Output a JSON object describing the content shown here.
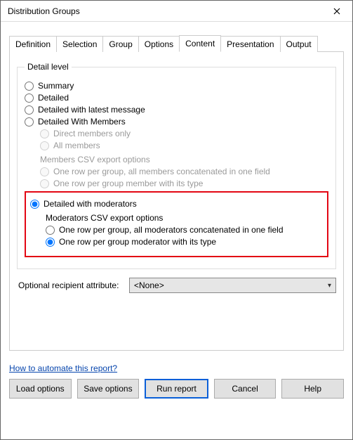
{
  "window": {
    "title": "Distribution Groups"
  },
  "tabs": {
    "items": [
      "Definition",
      "Selection",
      "Group",
      "Options",
      "Content",
      "Presentation",
      "Output"
    ],
    "active": "Content"
  },
  "detail": {
    "legend": "Detail level",
    "summary": "Summary",
    "detailed": "Detailed",
    "detailed_latest": "Detailed with latest message",
    "detailed_members": "Detailed With Members",
    "direct_only": "Direct members only",
    "all_members": "All members",
    "members_csv_head": "Members CSV export options",
    "members_csv_one_row_concat": "One row per group, all members concatenated in one field",
    "members_csv_one_row_member": "One row per group member with its type",
    "detailed_moderators": "Detailed with moderators",
    "mods_csv_head": "Moderators CSV export options",
    "mods_csv_one_row_concat": "One row per group, all moderators concatenated in one field",
    "mods_csv_one_row_mod": "One row per group moderator with its type",
    "selected_top": "detailed_moderators",
    "selected_mod_sub": "one_row_mod"
  },
  "attribute": {
    "label": "Optional recipient attribute:",
    "value": "<None>"
  },
  "link": {
    "text": "How to automate this report?"
  },
  "buttons": {
    "load": "Load options",
    "save": "Save options",
    "run": "Run report",
    "cancel": "Cancel",
    "help": "Help"
  }
}
